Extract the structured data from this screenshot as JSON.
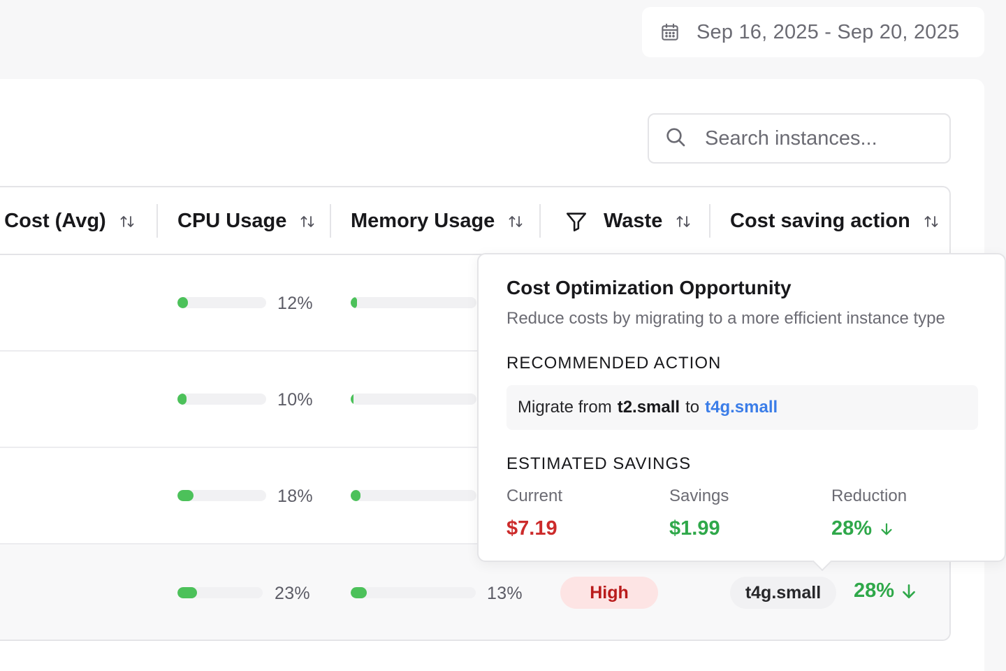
{
  "header": {
    "date_range": "Sep 16, 2025 - Sep 20, 2025",
    "calendar_icon": "calendar-icon"
  },
  "search": {
    "placeholder": "Search instances...",
    "value": ""
  },
  "table": {
    "columns": [
      {
        "label": "y Cost (Avg)",
        "sortable": true
      },
      {
        "label": "CPU Usage",
        "sortable": true
      },
      {
        "label": "Memory Usage",
        "sortable": true
      },
      {
        "label": "Waste",
        "sortable": true,
        "filter": true
      },
      {
        "label": "Cost saving action",
        "sortable": true
      }
    ],
    "rows": [
      {
        "cpu_pct": 12,
        "cpu_label": "12%",
        "mem_pct": 5
      },
      {
        "cpu_pct": 10,
        "cpu_label": "10%",
        "mem_pct": 2
      },
      {
        "cpu_pct": 18,
        "cpu_label": "18%",
        "mem_pct": 8
      },
      {
        "cpu_pct": 23,
        "cpu_label": "23%",
        "mem_pct": 13,
        "mem_label": "13%",
        "waste": "High",
        "instance_type": "t4g.small",
        "saving": "28%"
      }
    ]
  },
  "popover": {
    "title": "Cost Optimization Opportunity",
    "subtitle": "Reduce costs by migrating to a more efficient instance type",
    "recommended_heading": "RECOMMENDED ACTION",
    "action_prefix": "Migrate from",
    "from_type": "t2.small",
    "action_to": "to",
    "to_type": "t4g.small",
    "savings_heading": "ESTIMATED SAVINGS",
    "current_label": "Current",
    "current_value": "$7.19",
    "savings_label": "Savings",
    "savings_value": "$1.99",
    "reduction_label": "Reduction",
    "reduction_value": "28%"
  },
  "colors": {
    "green": "#2fa84a",
    "red": "#cc2b2b",
    "link_blue": "#3b7de8",
    "bar_fill": "#4cc15a"
  }
}
